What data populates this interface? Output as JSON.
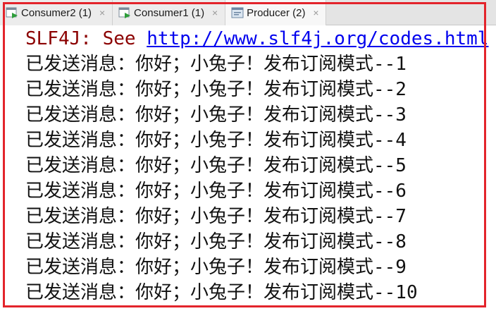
{
  "tabs": [
    {
      "label": "Consumer2 (1)",
      "icon": "java-app-icon",
      "close": "×",
      "active": false
    },
    {
      "label": "Consumer1 (1)",
      "icon": "java-app-icon",
      "close": "×",
      "active": false
    },
    {
      "label": "Producer (2)",
      "icon": "console-icon",
      "close": "×",
      "active": true
    }
  ],
  "console": {
    "warning_prefix": "SLF4J: See ",
    "warning_link": "http://www.slf4j.org/codes.html",
    "lines": [
      "已发送消息：你好；小兔子！发布订阅模式--1",
      "已发送消息：你好；小兔子！发布订阅模式--2",
      "已发送消息：你好；小兔子！发布订阅模式--3",
      "已发送消息：你好；小兔子！发布订阅模式--4",
      "已发送消息：你好；小兔子！发布订阅模式--5",
      "已发送消息：你好；小兔子！发布订阅模式--6",
      "已发送消息：你好；小兔子！发布订阅模式--7",
      "已发送消息：你好；小兔子！发布订阅模式--8",
      "已发送消息：你好；小兔子！发布订阅模式--9",
      "已发送消息：你好；小兔子！发布订阅模式--10"
    ]
  },
  "colors": {
    "highlight": "#e3242b",
    "stderr": "#8b0000",
    "link": "#0000ee",
    "text": "#111111"
  }
}
